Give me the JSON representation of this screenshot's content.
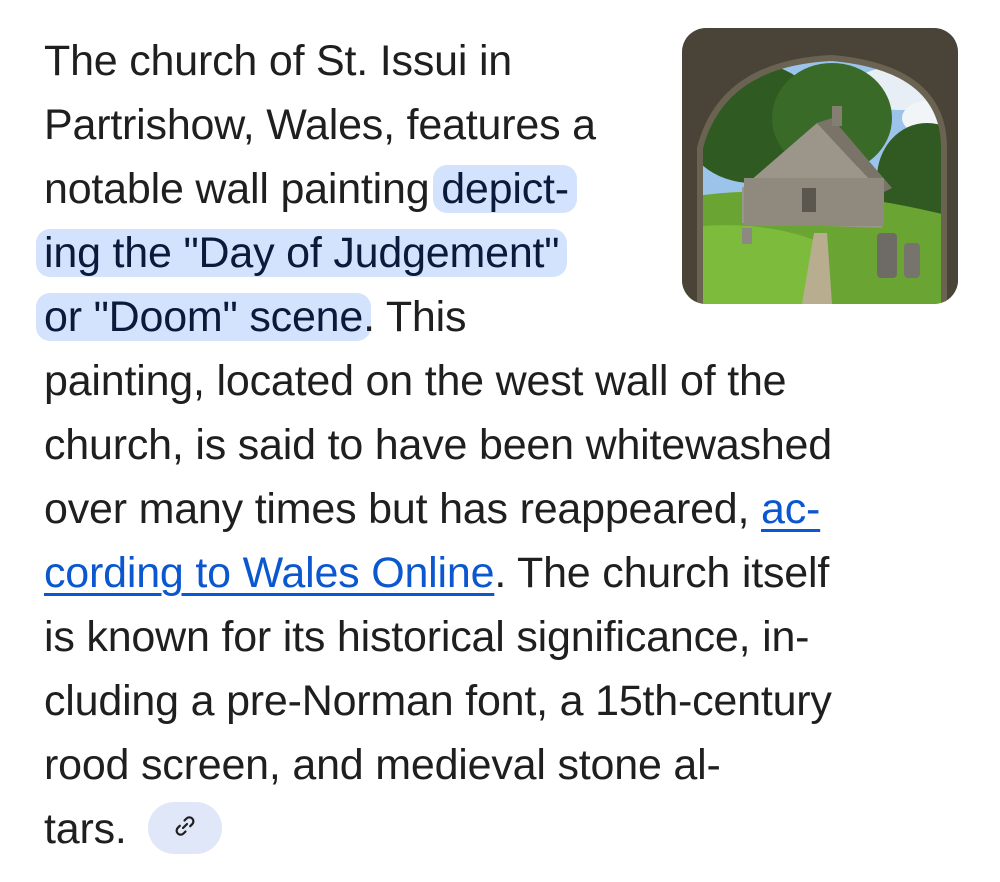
{
  "answer": {
    "lines": [
      {
        "parts": [
          "The church of St. Issui in"
        ]
      },
      {
        "parts": [
          "Partrishow, Wales, features a"
        ]
      },
      {
        "parts": [
          "notable wall painting ",
          "depict-"
        ]
      },
      {
        "parts": [
          "ing the \"Day of Judgement\""
        ]
      },
      {
        "parts": [
          "or \"Doom\" scene",
          ". This"
        ]
      },
      {
        "parts": [
          "painting, located on the west wall of the"
        ]
      },
      {
        "parts": [
          "church, is said to have been whitewashed"
        ]
      },
      {
        "parts": [
          "over many times but has reappeared, ",
          "ac-"
        ]
      },
      {
        "parts": [
          "cording to Wales Online",
          ". The church itself"
        ]
      },
      {
        "parts": [
          "is known for its historical significance, in-"
        ]
      },
      {
        "parts": [
          "cluding a pre-Norman font, a 15th-century"
        ]
      },
      {
        "parts": [
          "rood screen, and medieval stone al-"
        ]
      },
      {
        "parts": [
          "tars."
        ]
      }
    ]
  },
  "image": {
    "icon": "church-photo",
    "subject": "St. Issui church, Partrishow"
  },
  "citation": {
    "icon": "link-icon"
  },
  "colors": {
    "highlight": "#d3e3fd",
    "link": "#0b57d0",
    "chip": "#dfe7f8",
    "text": "#1f1f1f"
  }
}
